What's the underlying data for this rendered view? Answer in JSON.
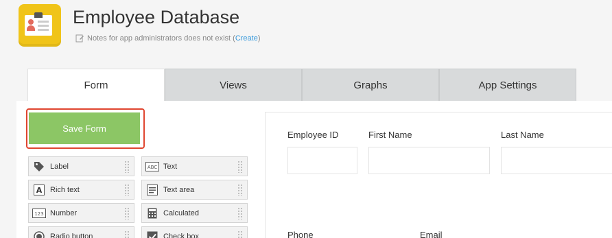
{
  "app": {
    "title": "Employee Database",
    "notes_text": "Notes for app administrators does not exist (",
    "notes_link": "Create",
    "notes_close": ")",
    "icon": "employee-card-icon",
    "icon_color": "#f0c419"
  },
  "tabs": [
    {
      "label": "Form",
      "active": true
    },
    {
      "label": "Views",
      "active": false
    },
    {
      "label": "Graphs",
      "active": false
    },
    {
      "label": "App Settings",
      "active": false
    }
  ],
  "palette": {
    "save_label": "Save Form",
    "save_color": "#8cc665",
    "highlight_color": "#e0452f",
    "fields": [
      {
        "label": "Label",
        "icon": "tag-icon"
      },
      {
        "label": "Text",
        "icon": "abc-text-icon"
      },
      {
        "label": "Rich text",
        "icon": "rich-text-icon"
      },
      {
        "label": "Text area",
        "icon": "text-area-icon"
      },
      {
        "label": "Number",
        "icon": "number-123-icon"
      },
      {
        "label": "Calculated",
        "icon": "calculator-icon"
      },
      {
        "label": "Radio button",
        "icon": "radio-button-icon"
      },
      {
        "label": "Check box",
        "icon": "check-box-icon"
      }
    ]
  },
  "form": {
    "fields": [
      {
        "label": "Employee ID"
      },
      {
        "label": "First Name"
      },
      {
        "label": "Last Name"
      },
      {
        "label": "Phone"
      },
      {
        "label": "Email"
      }
    ]
  }
}
